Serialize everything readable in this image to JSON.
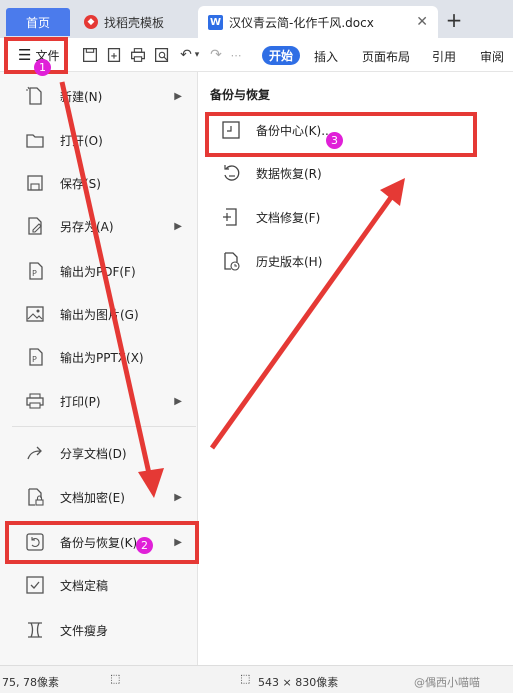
{
  "tabs": {
    "home": "首页",
    "templates": "找稻壳模板",
    "document": "汉仪青云简-化作千风.docx",
    "logo_letter": "W"
  },
  "toolbar": {
    "file_label": "文件",
    "ribbon_tabs": [
      "开始",
      "插入",
      "页面布局",
      "引用",
      "审阅"
    ]
  },
  "file_menu": {
    "items": [
      {
        "label": "新建(N)",
        "icon": "new-doc-icon",
        "arrow": true
      },
      {
        "label": "打开(O)",
        "icon": "folder-icon",
        "arrow": false
      },
      {
        "label": "保存(S)",
        "icon": "save-icon",
        "arrow": false
      },
      {
        "label": "另存为(A)",
        "icon": "save-as-icon",
        "arrow": true
      },
      {
        "label": "输出为PDF(F)",
        "icon": "pdf-icon",
        "arrow": false
      },
      {
        "label": "输出为图片(G)",
        "icon": "image-icon",
        "arrow": false
      },
      {
        "label": "输出为PPTX(X)",
        "icon": "pptx-icon",
        "arrow": false
      },
      {
        "label": "打印(P)",
        "icon": "print-icon",
        "arrow": true
      },
      {
        "label": "分享文档(D)",
        "icon": "share-icon",
        "arrow": false
      },
      {
        "label": "文档加密(E)",
        "icon": "lock-doc-icon",
        "arrow": true
      },
      {
        "label": "备份与恢复(K)",
        "icon": "backup-icon",
        "arrow": true
      },
      {
        "label": "文档定稿",
        "icon": "finalize-icon",
        "arrow": false
      },
      {
        "label": "文件瘦身",
        "icon": "slim-icon",
        "arrow": false
      }
    ]
  },
  "submenu": {
    "title": "备份与恢复",
    "items": [
      {
        "label": "备份中心(K)...",
        "icon": "backup-center-icon"
      },
      {
        "label": "数据恢复(R)",
        "icon": "data-recovery-icon"
      },
      {
        "label": "文档修复(F)",
        "icon": "doc-repair-icon"
      },
      {
        "label": "历史版本(H)",
        "icon": "history-icon"
      }
    ]
  },
  "annotations": {
    "badges": [
      "1",
      "2",
      "3"
    ],
    "highlight_color": "#e53935",
    "badge_color": "#e020d8"
  },
  "status": {
    "cursor": "75, 78像素",
    "size": "543 × 830像素",
    "watermark": "@偶西小喵喵"
  }
}
